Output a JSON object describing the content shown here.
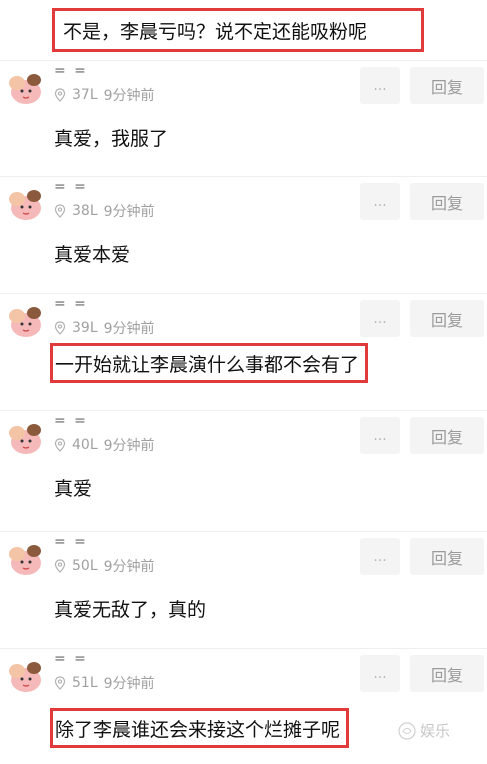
{
  "top_text": "不是，李晨亏吗？说不定还能吸粉呢",
  "buttons": {
    "more_label": "...",
    "reply_label": "回复"
  },
  "comments": [
    {
      "username": "= =",
      "floor": "37L",
      "time": "9分钟前",
      "content": "真爱，我服了",
      "highlighted": false
    },
    {
      "username": "= =",
      "floor": "38L",
      "time": "9分钟前",
      "content": "真爱本爱",
      "highlighted": false
    },
    {
      "username": "= =",
      "floor": "39L",
      "time": "9分钟前",
      "content": "一开始就让李晨演什么事都不会有了",
      "highlighted": true
    },
    {
      "username": "= =",
      "floor": "40L",
      "time": "9分钟前",
      "content": "真爱",
      "highlighted": false
    },
    {
      "username": "= =",
      "floor": "50L",
      "time": "9分钟前",
      "content": "真爱无敌了，真的",
      "highlighted": false
    },
    {
      "username": "= =",
      "floor": "51L",
      "time": "9分钟前",
      "content": "除了李晨谁还会来接这个烂摊子呢",
      "highlighted": true
    }
  ],
  "watermark": "娱乐",
  "colors": {
    "highlight_border": "#e03a3a",
    "meta_text": "#a0a0a0",
    "button_bg": "#f4f4f4"
  }
}
